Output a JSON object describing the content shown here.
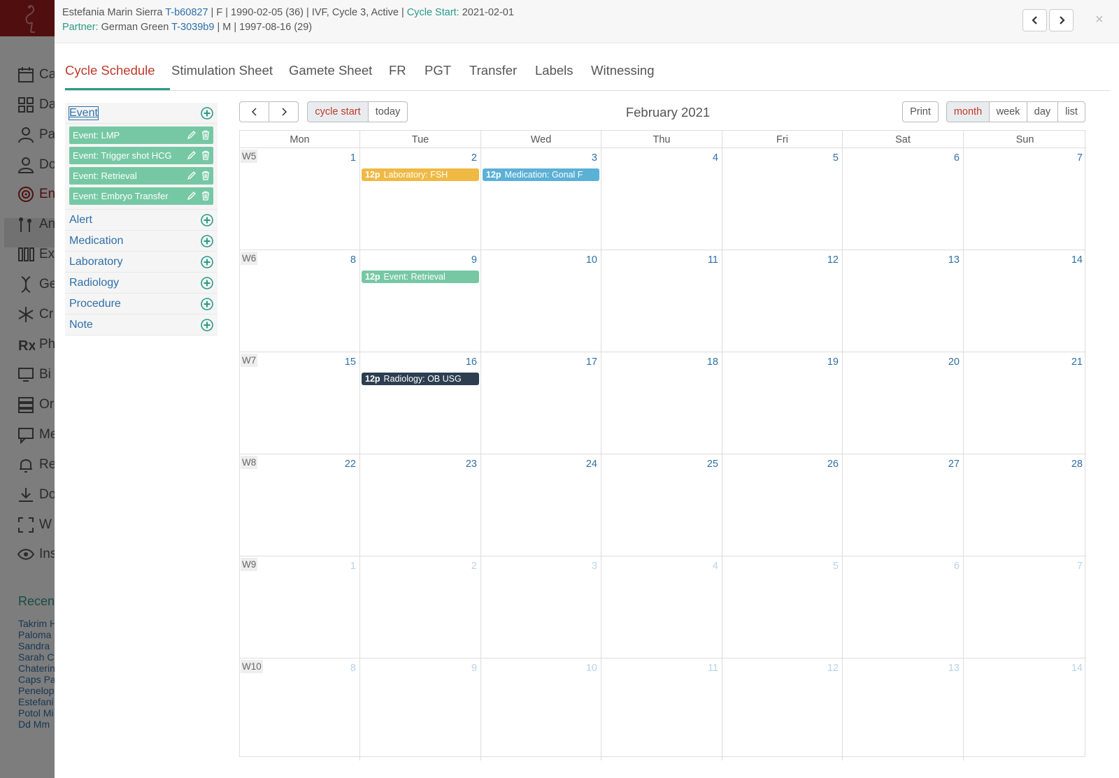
{
  "patient": {
    "name": "Estefania Marin Sierra",
    "id": "T-b60827",
    "details": "| F | 1990-02-05 (36) | IVF, Cycle 3, Active |",
    "cycle_start_label": "Cycle Start:",
    "cycle_start": "2021-02-01",
    "partner_label": "Partner:",
    "partner_name": "German Green",
    "partner_id": "T-3039b9",
    "partner_details": "| M | 1997-08-16 (29)"
  },
  "close_glyph": "×",
  "tabs": [
    {
      "label": "Cycle Schedule"
    },
    {
      "label": "Stimulation Sheet"
    },
    {
      "label": "Gamete Sheet"
    },
    {
      "label": "FR"
    },
    {
      "label": "PGT"
    },
    {
      "label": "Transfer"
    },
    {
      "label": "Labels"
    },
    {
      "label": "Witnessing"
    }
  ],
  "sidebar": {
    "categories": [
      {
        "label": "Event"
      },
      {
        "label": "Alert"
      },
      {
        "label": "Medication"
      },
      {
        "label": "Laboratory"
      },
      {
        "label": "Radiology"
      },
      {
        "label": "Procedure"
      },
      {
        "label": "Note"
      }
    ],
    "events": [
      {
        "label": "Event: LMP"
      },
      {
        "label": "Event: Trigger shot HCG"
      },
      {
        "label": "Event: Retrieval"
      },
      {
        "label": "Event: Embryo Transfer"
      }
    ]
  },
  "toolbar": {
    "cycle_start": "cycle start",
    "today": "today",
    "title": "February 2021",
    "print": "Print",
    "month": "month",
    "week": "week",
    "day": "day",
    "list": "list"
  },
  "calendar": {
    "days_of_week": [
      "Mon",
      "Tue",
      "Wed",
      "Thu",
      "Fri",
      "Sat",
      "Sun"
    ],
    "weeks": [
      {
        "label": "W5",
        "days": [
          "1",
          "2",
          "3",
          "4",
          "5",
          "6",
          "7"
        ]
      },
      {
        "label": "W6",
        "days": [
          "8",
          "9",
          "10",
          "11",
          "12",
          "13",
          "14"
        ]
      },
      {
        "label": "W7",
        "days": [
          "15",
          "16",
          "17",
          "18",
          "19",
          "20",
          "21"
        ]
      },
      {
        "label": "W8",
        "days": [
          "22",
          "23",
          "24",
          "25",
          "26",
          "27",
          "28"
        ]
      },
      {
        "label": "W9",
        "days": [
          "1",
          "2",
          "3",
          "4",
          "5",
          "6",
          "7"
        ]
      },
      {
        "label": "W10",
        "days": [
          "8",
          "9",
          "10",
          "11",
          "12",
          "13",
          "14"
        ]
      }
    ],
    "events": [
      {
        "time": "12p",
        "title": "Laboratory: FSH",
        "date": "2021-02-02",
        "color": "#efb944"
      },
      {
        "time": "12p",
        "title": "Medication: Gonal F",
        "date": "2021-02-03",
        "color": "#5bb0d6"
      },
      {
        "time": "12p",
        "title": "Event: Retrieval",
        "date": "2021-02-09",
        "color": "#76c8a4"
      },
      {
        "time": "12p",
        "title": "Radiology: OB USG",
        "date": "2021-02-16",
        "color": "#2c3e50"
      }
    ]
  },
  "background": {
    "nav_items": [
      {
        "label": "Ca",
        "icon": "calendar-icon"
      },
      {
        "label": "Da",
        "icon": "dashboard-icon"
      },
      {
        "label": "Pa",
        "icon": "patient-icon"
      },
      {
        "label": "Do",
        "icon": "doctor-icon"
      },
      {
        "label": "En",
        "icon": "target-icon"
      },
      {
        "label": "An",
        "icon": "sperm-icon"
      },
      {
        "label": "Ex",
        "icon": "tubes-icon"
      },
      {
        "label": "Ge",
        "icon": "dna-icon"
      },
      {
        "label": "Cr",
        "icon": "snowflake-icon"
      },
      {
        "label": "Ph",
        "icon": "prescription-icon"
      },
      {
        "label": "Bi",
        "icon": "billing-icon"
      },
      {
        "label": "Or",
        "icon": "orders-icon"
      },
      {
        "label": "Me",
        "icon": "messages-icon"
      },
      {
        "label": "Re",
        "icon": "bell-icon"
      },
      {
        "label": "Do",
        "icon": "download-icon"
      },
      {
        "label": "W",
        "icon": "expand-icon"
      },
      {
        "label": "Ins",
        "icon": "eye-icon"
      }
    ],
    "recent_title": "Recen",
    "recent_items": [
      "Takrim H",
      "Paloma",
      "Sandra",
      "Sarah C",
      "Chaterin",
      "Caps Pa",
      "Penelop",
      "Estefani",
      "Potol Mi",
      "Dd Mm"
    ]
  }
}
